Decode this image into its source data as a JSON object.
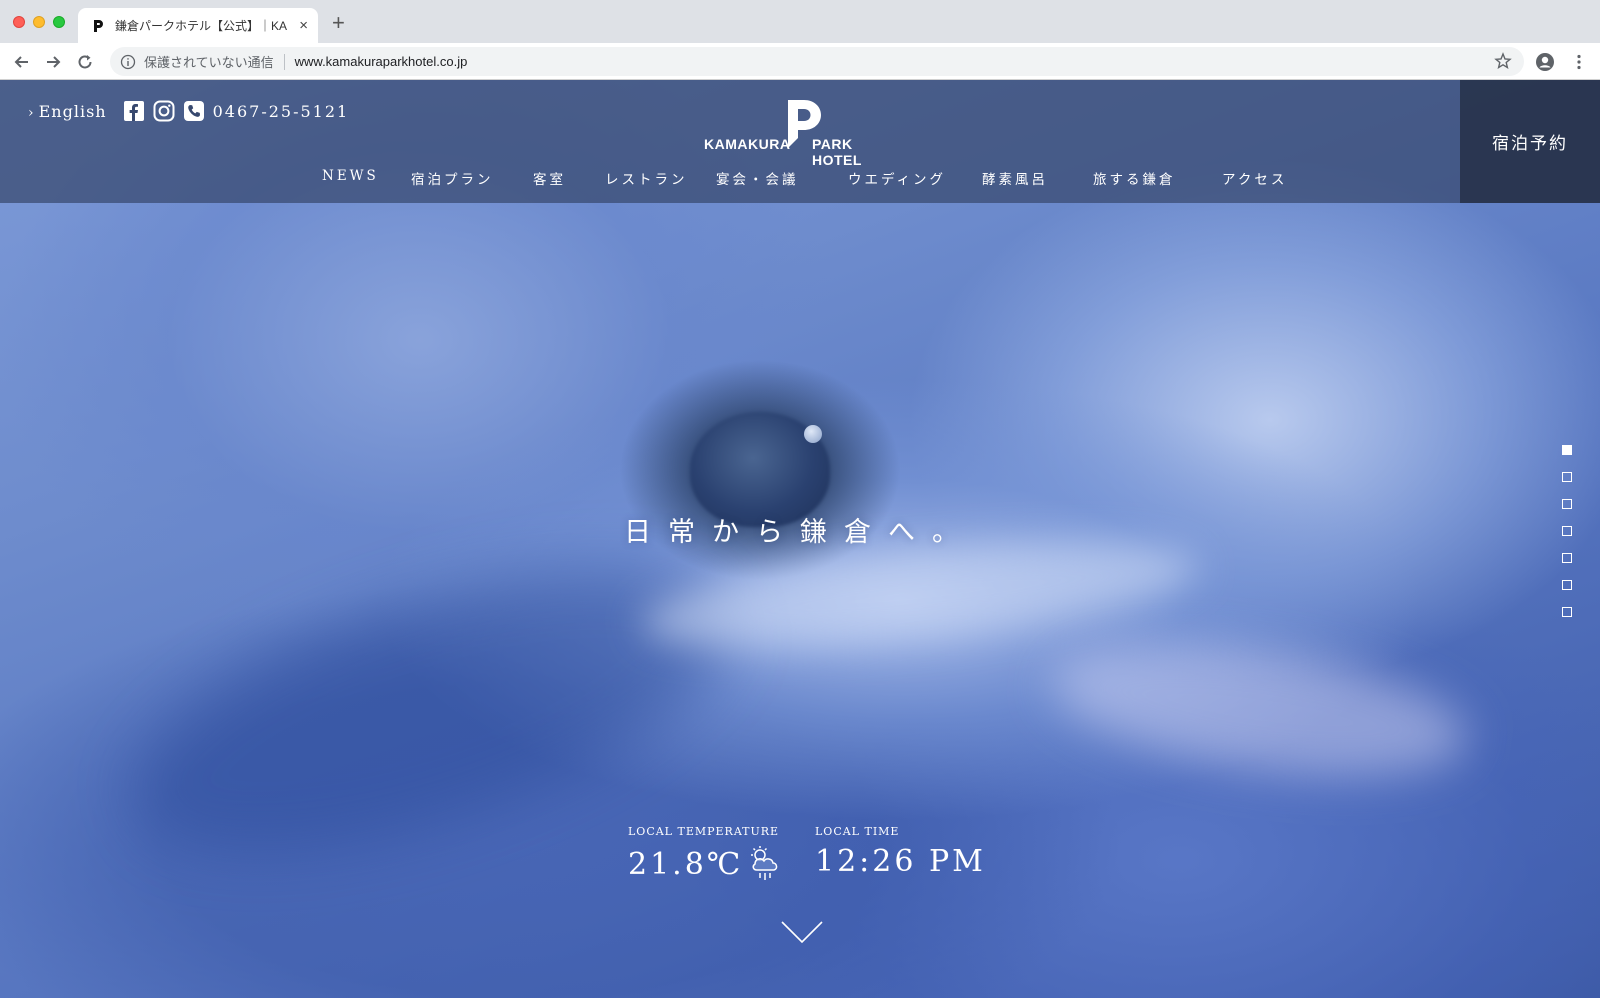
{
  "browser": {
    "tab_title": "鎌倉パークホテル【公式】｜KA",
    "new_tab_label": "+",
    "close_label": "×",
    "security_label": "保護されていない通信",
    "url": "www.kamakuraparkhotel.co.jp"
  },
  "header": {
    "english_label": "English",
    "phone": "0467-25-5121",
    "logo_left": "KAMAKURA",
    "logo_right": "PARK HOTEL",
    "reserve_label": "宿泊予約"
  },
  "nav": {
    "items": [
      {
        "label": "NEWS"
      },
      {
        "label": "宿泊プラン"
      },
      {
        "label": "客室"
      },
      {
        "label": "レストラン"
      },
      {
        "label": "宴会・会議"
      },
      {
        "label": "ウエディング"
      },
      {
        "label": "酵素風呂"
      },
      {
        "label": "旅する鎌倉"
      },
      {
        "label": "アクセス"
      }
    ]
  },
  "hero": {
    "tagline": "日常から鎌倉へ。",
    "slide_count": 7,
    "active_slide": 1
  },
  "info": {
    "temperature_label": "LOCAL TEMPERATURE",
    "temperature_value": "21.8℃",
    "weather_icon": "cloud-rain-sun-icon",
    "time_label": "LOCAL TIME",
    "time_value": "12:26 PM"
  },
  "colors": {
    "header_bg": "#37486e",
    "reserve_bg": "#263048",
    "hero_blue": "#6e8ccd"
  }
}
